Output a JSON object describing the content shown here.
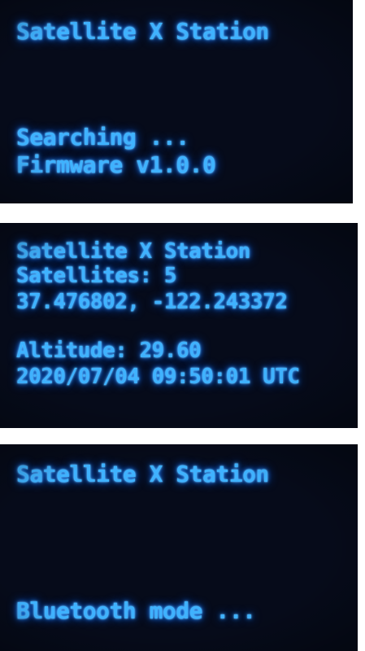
{
  "screens": [
    {
      "title": "Satellite X Station",
      "lines": [
        "Searching ...",
        "Firmware v1.0.0"
      ]
    },
    {
      "title": "Satellite X Station",
      "lines": [
        "Satellites: 5",
        "37.476802, -122.243372",
        "Altitude: 29.60",
        "2020/07/04 09:50:01 UTC"
      ]
    },
    {
      "title": "Satellite X Station",
      "lines": [
        "Bluetooth mode ..."
      ]
    }
  ],
  "colors": {
    "screen_background": "#060b1a",
    "text_glow": "#3fb2ff",
    "separator": "#ffffff"
  }
}
